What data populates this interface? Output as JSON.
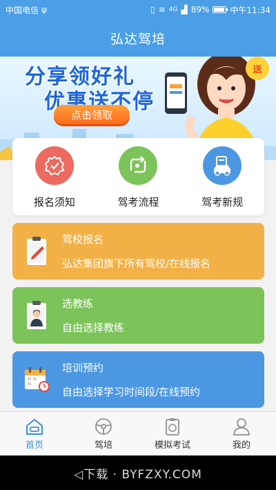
{
  "status_bar": {
    "carrier": "中国电信",
    "battery": "89%",
    "time": "中午11:34",
    "network": "4G",
    "battery_level": 0.89
  },
  "header": {
    "title": "弘达驾培"
  },
  "banner": {
    "line1": "分享领好礼",
    "line2": "优惠送不停",
    "cta": "点击领取",
    "badge": "送"
  },
  "quick_links": [
    {
      "label": "报名须知",
      "color": "#ec6a5f",
      "icon": "badge-check-icon"
    },
    {
      "label": "驾考流程",
      "color": "#7cc35a",
      "icon": "flow-arrow-icon"
    },
    {
      "label": "驾考新规",
      "color": "#4b97e2",
      "icon": "car-doc-icon"
    }
  ],
  "cards": [
    {
      "title": "驾校报名",
      "subtitle": "弘达集团旗下所有驾校/在线报名",
      "color": "#f2b146",
      "icon": "clipboard-pen-icon"
    },
    {
      "title": "选教练",
      "subtitle": "自由选择教练",
      "color": "#7cc35a",
      "icon": "clipboard-person-icon"
    },
    {
      "title": "培训预约",
      "subtitle": "自由选择学习时间段/在线预约",
      "color": "#4b97e2",
      "icon": "calendar-clock-icon"
    }
  ],
  "bottom_nav": [
    {
      "label": "首页",
      "icon": "home-icon",
      "active": true
    },
    {
      "label": "驾培",
      "icon": "steering-wheel-icon",
      "active": false
    },
    {
      "label": "模拟考试",
      "icon": "exam-icon",
      "active": false
    },
    {
      "label": "我的",
      "icon": "user-icon",
      "active": false
    }
  ],
  "system_bar": {
    "watermark": "◁下载 · BYFZXY.COM"
  }
}
